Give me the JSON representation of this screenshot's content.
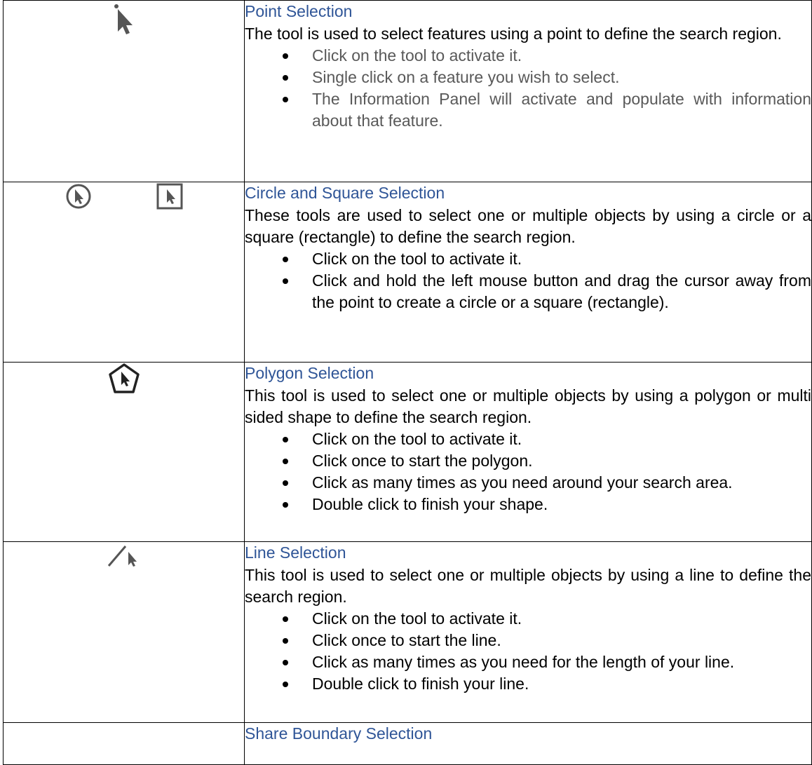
{
  "rows": [
    {
      "title": "Point Selection",
      "description": "The tool is used to select features using a point to define the search region.",
      "icons": [
        "point-select-icon"
      ],
      "steps": [
        "Click on the tool to activate it.",
        "Single click on a feature you wish to select.",
        "The Information Panel will activate and populate with information about that feature."
      ]
    },
    {
      "title": "Circle and Square Selection",
      "description": "These tools are used to select one or multiple objects by using a circle or a square (rectangle) to define the search region.",
      "icons": [
        "circle-select-icon",
        "square-select-icon"
      ],
      "steps": [
        "Click on the tool to activate it.",
        "Click and hold the left mouse button and drag the cursor away from the point to create a circle or a square (rectangle)."
      ]
    },
    {
      "title": "Polygon Selection",
      "description": "This tool is used to select one or multiple objects by using a polygon or multi sided shape to define the search region.",
      "icons": [
        "polygon-select-icon"
      ],
      "steps": [
        "Click on the tool to activate it.",
        "Click once to start the polygon.",
        "Click as many times as you need around your search area.",
        "Double click to finish your shape."
      ]
    },
    {
      "title": "Line Selection",
      "description": "This tool is used to select one or multiple objects by using a line to define the search region.",
      "icons": [
        "line-select-icon"
      ],
      "steps": [
        "Click on the tool to activate it.",
        "Click once to start the line.",
        "Click as many times as you need for the length of your line.",
        "Double click to finish your line."
      ]
    },
    {
      "title": "Share Boundary Selection"
    }
  ],
  "colors": {
    "heading": "#2F5597",
    "grey_text": "#595959",
    "icon": "#555555"
  }
}
